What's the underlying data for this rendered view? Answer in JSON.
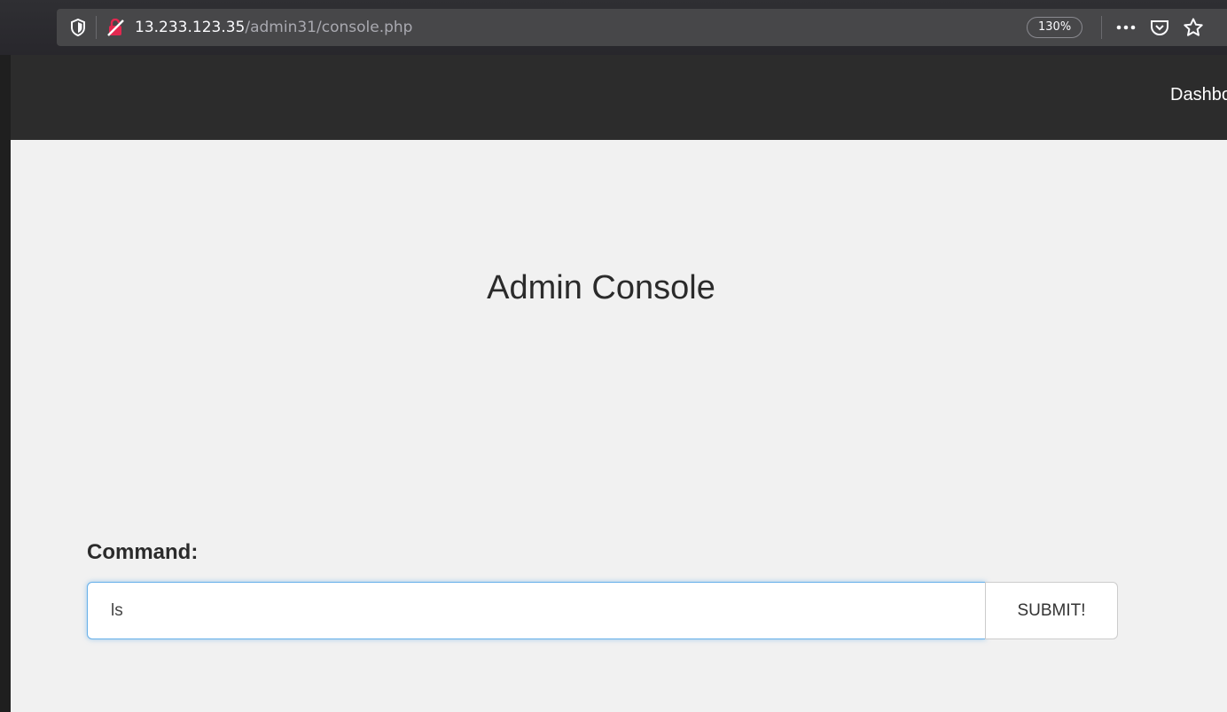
{
  "browser": {
    "url_host": "13.233.123.35",
    "url_path": "/admin31/console.php",
    "zoom": "130%",
    "icons": [
      "shield-icon",
      "insecure-lock-icon",
      "more-icon",
      "pocket-icon",
      "star-icon"
    ]
  },
  "navbar": {
    "link_label": "Dashboard"
  },
  "page": {
    "title": "Admin Console",
    "command_label": "Command:",
    "command_value": "ls",
    "submit_label": "SUBMIT!"
  },
  "colors": {
    "navbar_bg": "#2c2c2c",
    "page_bg": "#f1f1f1",
    "focus_ring": "#66afe9",
    "insecure_icon": "#e22850"
  }
}
